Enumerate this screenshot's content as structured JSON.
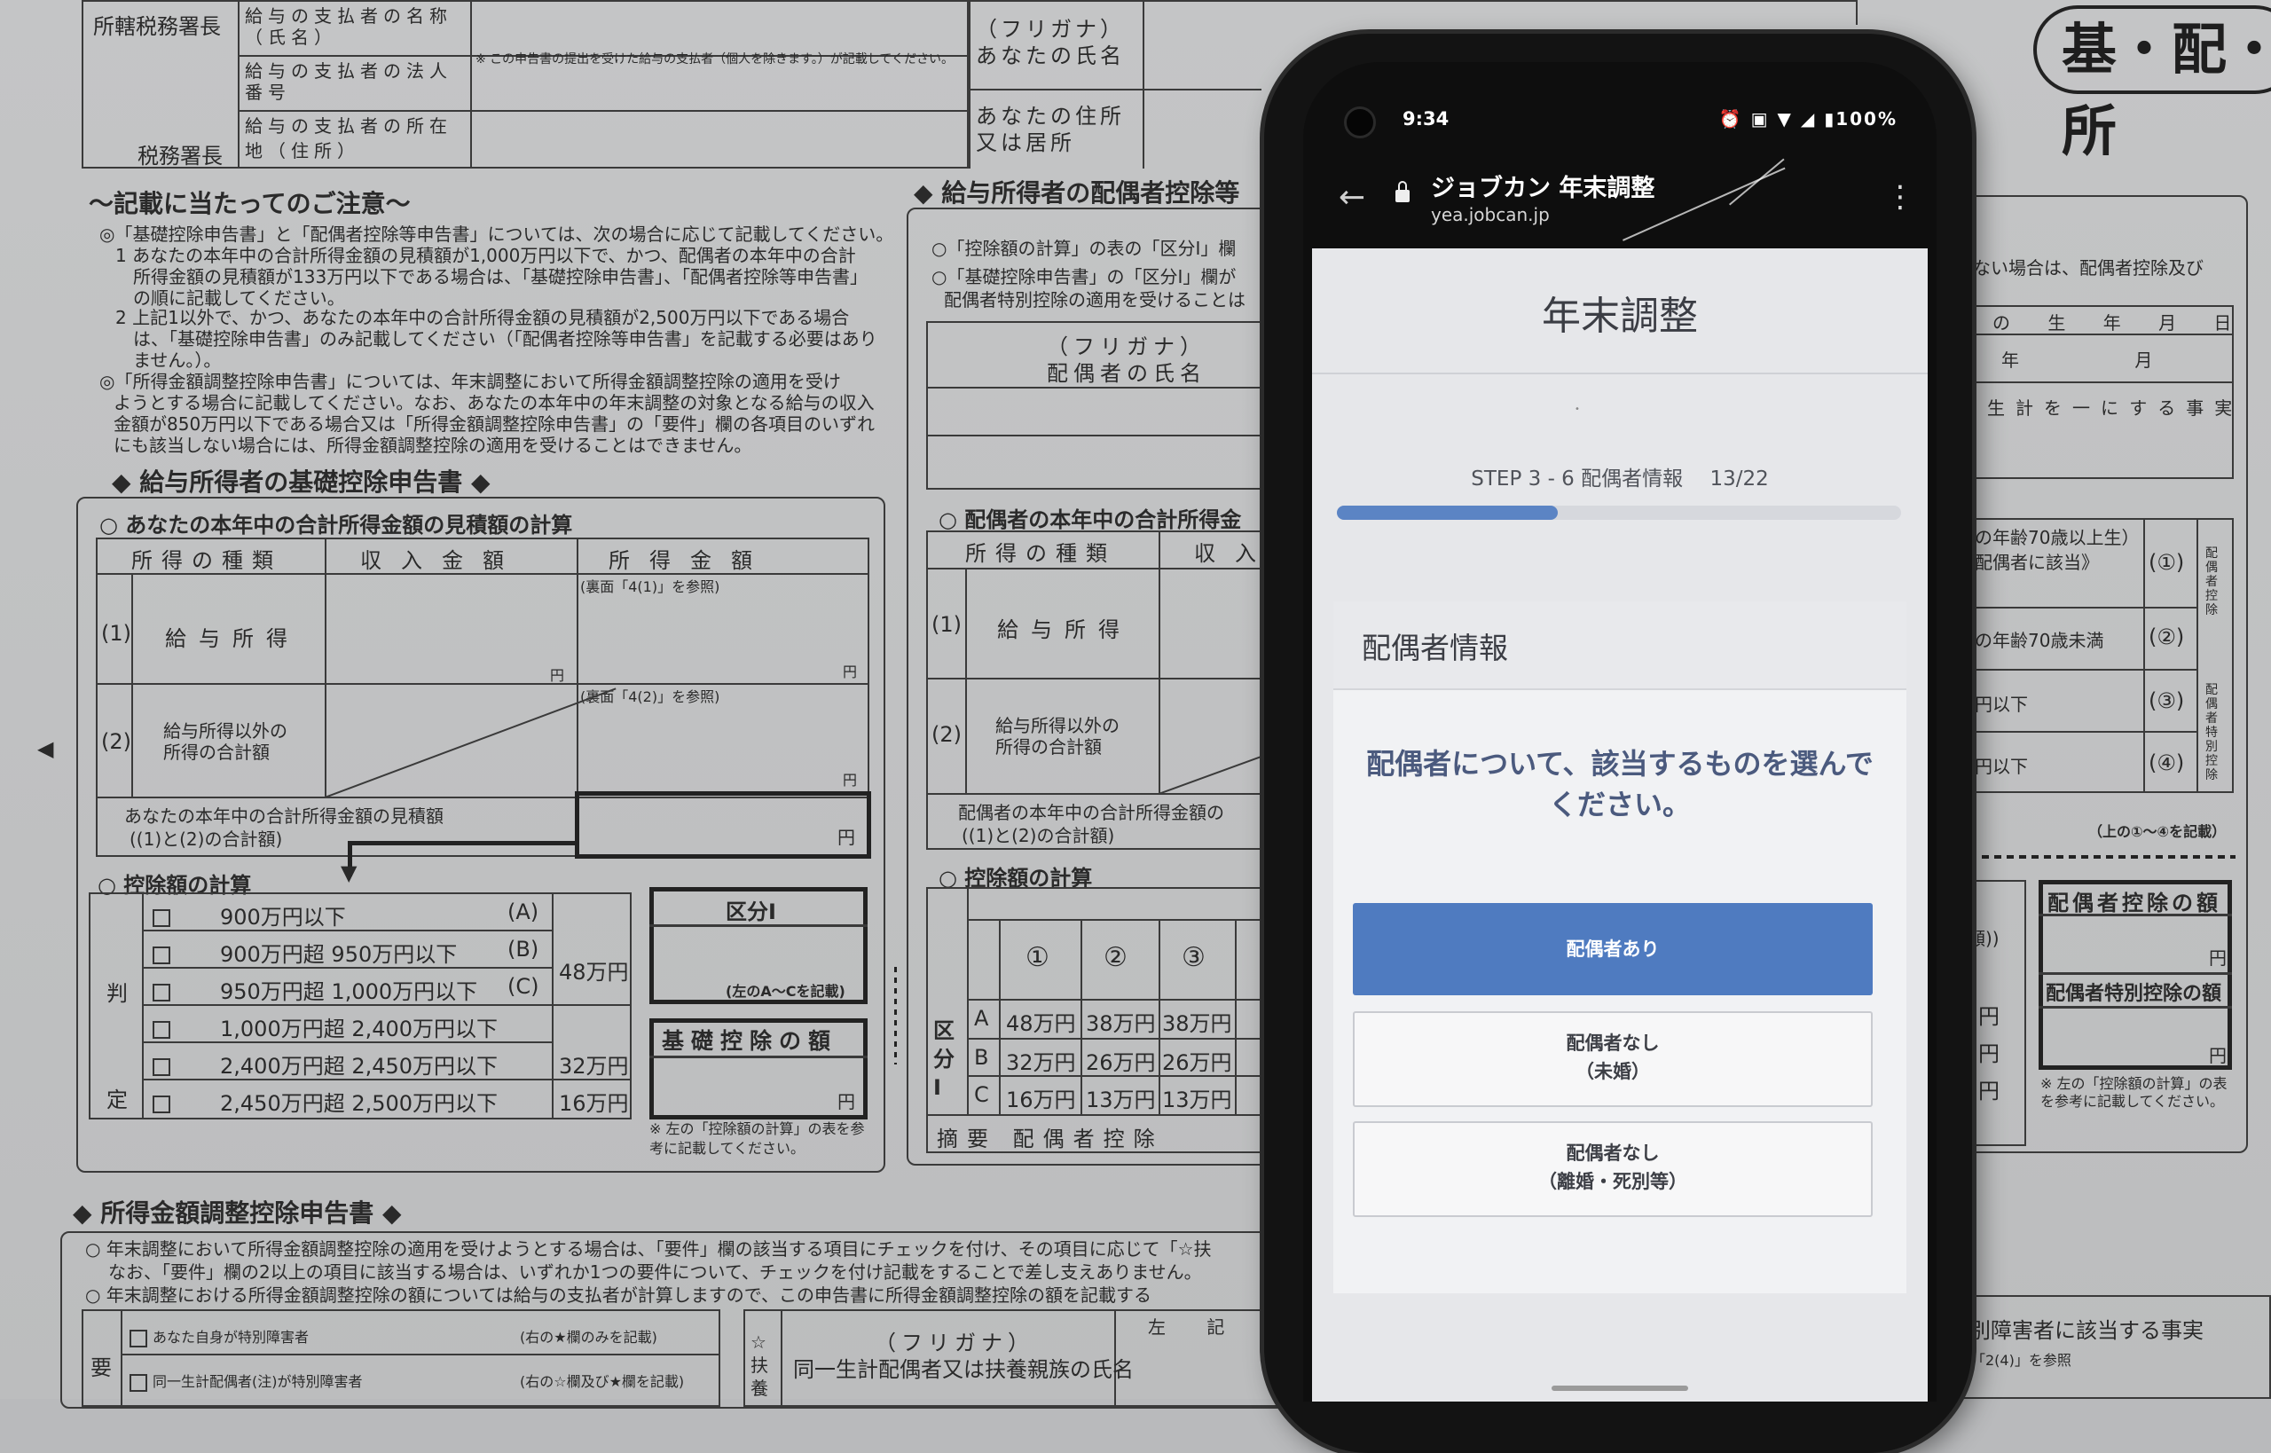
{
  "form": {
    "header": {
      "office_label": "所轄税務署長",
      "office_suffix": "税務署長",
      "payer_name": "給与の支払者の名称（氏名）",
      "payer_number": "給与の支払者の法人番号",
      "payer_address": "給与の支払者の所在地（住所）",
      "payer_note": "※ この申告書の提出を受けた給与の支払者（個人を除きます。）が記載してください。",
      "furigana_name": "（フリガナ）あなたの氏名",
      "address": "あなたの住所又は居所",
      "stamp": "基・配・所"
    },
    "notes": {
      "title": "～記載に当たってのご注意～",
      "lines": [
        "◎「基礎控除申告書」と「配偶者控除等申告書」については、次の場合に応じて記載してください。",
        "1 あなたの本年中の合計所得金額の見積額が1,000万円以下で、かつ、配偶者の本年中の合計",
        "所得金額の見積額が133万円以下である場合は、「基礎控除申告書」、「配偶者控除等申告書」",
        "の順に記載してください。",
        "2 上記1以外で、かつ、あなたの本年中の合計所得金額の見積額が2,500万円以下である場合",
        "は、「基礎控除申告書」のみ記載してください（「配偶者控除等申告書」を記載する必要はあり",
        "ません。）。",
        "◎「所得金額調整控除申告書」については、年末調整において所得金額調整控除の適用を受け",
        "ようとする場合に記載してください。なお、あなたの本年中の年末調整の対象となる給与の収入",
        "金額が850万円以下である場合又は「所得金額調整控除申告書」の「要件」欄の各項目のいずれ",
        "にも該当しない場合には、所得金額調整控除の適用を受けることはできません。"
      ]
    },
    "kiso": {
      "title": "◆ 給与所得者の基礎控除申告書 ◆",
      "estimate_title": "○ あなたの本年中の合計所得金額の見積額の計算",
      "cols": [
        "所得の種類",
        "収入金額",
        "所得金額"
      ],
      "row1_num": "(1)",
      "row1_label": "給与所得",
      "row1_ref": "(裏面「4(1)」を参照)",
      "row2_num": "(2)",
      "row2_label": "給与所得以外の所得の合計額",
      "row2_ref": "(裏面「4(2)」を参照)",
      "yen": "円",
      "total_label": "あなたの本年中の合計所得金額の見積額",
      "total_sub": "((1)と(2)の合計額)",
      "deduction_title": "○ 控除額の計算",
      "hantei": "判定",
      "rows": [
        {
          "range": "900万円以下",
          "code": "(A)",
          "amount": ""
        },
        {
          "range": "900万円超 950万円以下",
          "code": "(B)",
          "amount": "48万円"
        },
        {
          "range": "950万円超 1,000万円以下",
          "code": "(C)",
          "amount": ""
        },
        {
          "range": "1,000万円超 2,400万円以下",
          "code": "",
          "amount": ""
        },
        {
          "range": "2,400万円超 2,450万円以下",
          "code": "",
          "amount": "32万円"
        },
        {
          "range": "2,450万円超 2,500万円以下",
          "code": "",
          "amount": "16万円"
        }
      ],
      "kubun": "区分Ⅰ",
      "kubun_note": "(左のA～Cを記載)",
      "kiso_amount": "基礎控除の額",
      "kiso_note": "※ 左の「控除額の計算」の表を参考に記載してください。"
    },
    "haigusha": {
      "title": "◆ 給与所得者の配偶者控除等",
      "line1": "○「控除額の計算」の表の「区分Ⅰ」欄",
      "line2": "○「基礎控除申告書」の「区分Ⅰ」欄が",
      "line3": "配偶者特別控除の適用を受けることは",
      "furigana": "（フリガナ）配偶者の氏名",
      "estimate_title": "○ 配偶者の本年中の合計所得金",
      "cols": [
        "所得の種類",
        "収入"
      ],
      "row1_num": "(1)",
      "row1_label": "給与所得",
      "row2_num": "(2)",
      "row2_label": "給与所得以外の所得の合計額",
      "total_label": "配偶者の本年中の合計所得金額の",
      "total_sub": "((1)と(2)の合計額)",
      "deduction_title": "○ 控除額の計算",
      "circled": [
        "①",
        "②",
        "③"
      ],
      "kubun": "区分Ⅰ",
      "grid": [
        {
          "k": "A",
          "v": [
            "48万円",
            "38万円",
            "38万円"
          ]
        },
        {
          "k": "B",
          "v": [
            "32万円",
            "26万円",
            "26万円"
          ]
        },
        {
          "k": "C",
          "v": [
            "16万円",
            "13万円",
            "13万円"
          ]
        }
      ],
      "summary": "摘要 配偶者控除"
    },
    "right": {
      "note": "ない場合は、配偶者控除及び",
      "birth": "の 生 年 月 日",
      "ymd": "年 月 日",
      "seikei": "生計を一にする事実",
      "rows": [
        {
          "label": "の年齢70歳以上生）配偶者に該当》",
          "num": "(①)"
        },
        {
          "label": "の年齢70歳未満",
          "num": "(②)"
        },
        {
          "label": "円以下",
          "num": "(③)"
        },
        {
          "label": "円以下",
          "num": "(④)"
        }
      ],
      "side1": "配偶者控除",
      "side2": "配偶者特別控除",
      "foot": "（上の①～④を記載）",
      "ded_amount": "配偶者控除の額",
      "special_amount": "配偶者特別控除の額",
      "yen": "円",
      "note2": "※ 左の「控除額の計算」の表を参考に記載してください。",
      "amount_col": "額))",
      "amount_rows": [
        "円",
        "円",
        "円"
      ],
      "disabled": "別障害者に該当する事実",
      "disabled_ref": "「2(4)」を参照"
    },
    "shotoku": {
      "title": "◆ 所得金額調整控除申告書 ◆",
      "line1": "○ 年末調整において所得金額調整控除の適用を受けようとする場合は、「要件」欄の該当する項目にチェックを付け、その項目に応じて「☆扶",
      "line2": "なお、「要件」欄の2以上の項目に該当する場合は、いずれか1つの要件について、チェックを付け記載をすることで差し支えありません。",
      "line3": "○ 年末調整における所得金額調整控除の額については給与の支払者が計算しますので、この申告書に所得金額調整控除の額を記載する",
      "req": "要",
      "item1": "あなた自身が特別障害者",
      "item1_note": "(右の★欄のみを記載)",
      "item2": "同一生計配偶者(注)が特別障害者",
      "item2_note": "(右の☆欄及び★欄を記載)",
      "furigana": "（フリガナ）",
      "fuyo_name": "同一生計配偶者又は扶養親族の氏名",
      "fuyo": "☆扶養",
      "left_note": "左 記"
    }
  },
  "phone": {
    "status": {
      "time": "9:34",
      "battery": "100%"
    },
    "appbar": {
      "title": "ジョブカン 年末調整",
      "url": "yea.jobcan.jp"
    },
    "page": {
      "title": "年末調整",
      "step": "STEP 3 - 6 配偶者情報　 13/22",
      "progress_fraction": 0.391
    },
    "card": {
      "title": "配偶者情報",
      "question": "配偶者について、該当するものを選んでください。",
      "options": [
        {
          "label": "配偶者あり",
          "sub": ""
        },
        {
          "label": "配偶者なし",
          "sub": "（未婚）"
        },
        {
          "label": "配偶者なし",
          "sub": "（離婚・死別等）"
        }
      ]
    },
    "colors": {
      "accent": "#4f7bc0",
      "progress": "#5b84c4"
    }
  }
}
